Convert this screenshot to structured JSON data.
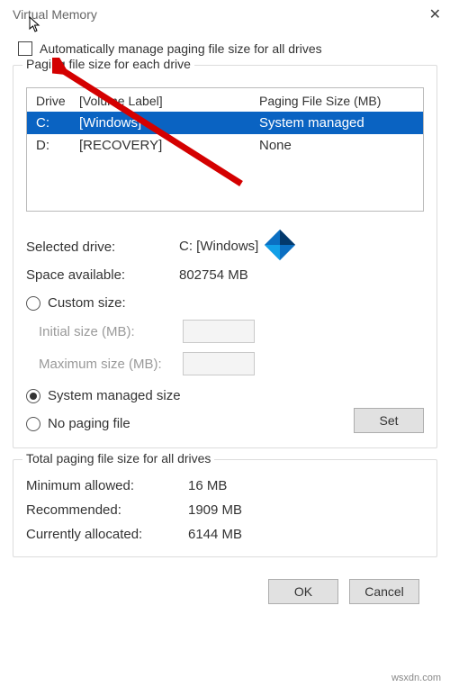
{
  "title": "Virtual Memory",
  "auto_label": "Automatically manage paging file size for all drives",
  "group1_legend": "Paging file size for each drive",
  "headers": {
    "drive": "Drive",
    "volume": "[Volume Label]",
    "size": "Paging File Size (MB)"
  },
  "drives": [
    {
      "letter": "C:",
      "label": "[Windows]",
      "size": "System managed"
    },
    {
      "letter": "D:",
      "label": "[RECOVERY]",
      "size": "None"
    }
  ],
  "selected_label": "Selected drive:",
  "selected_value": "C:  [Windows]",
  "space_label": "Space available:",
  "space_value": "802754 MB",
  "custom_label": "Custom size:",
  "initial_label": "Initial size (MB):",
  "max_label": "Maximum size (MB):",
  "sysman_label": "System managed size",
  "nopage_label": "No paging file",
  "set_btn": "Set",
  "group2_legend": "Total paging file size for all drives",
  "min_label": "Minimum allowed:",
  "min_value": "16 MB",
  "rec_label": "Recommended:",
  "rec_value": "1909 MB",
  "cur_label": "Currently allocated:",
  "cur_value": "6144 MB",
  "ok_btn": "OK",
  "cancel_btn": "Cancel",
  "watermark": "wsxdn.com"
}
